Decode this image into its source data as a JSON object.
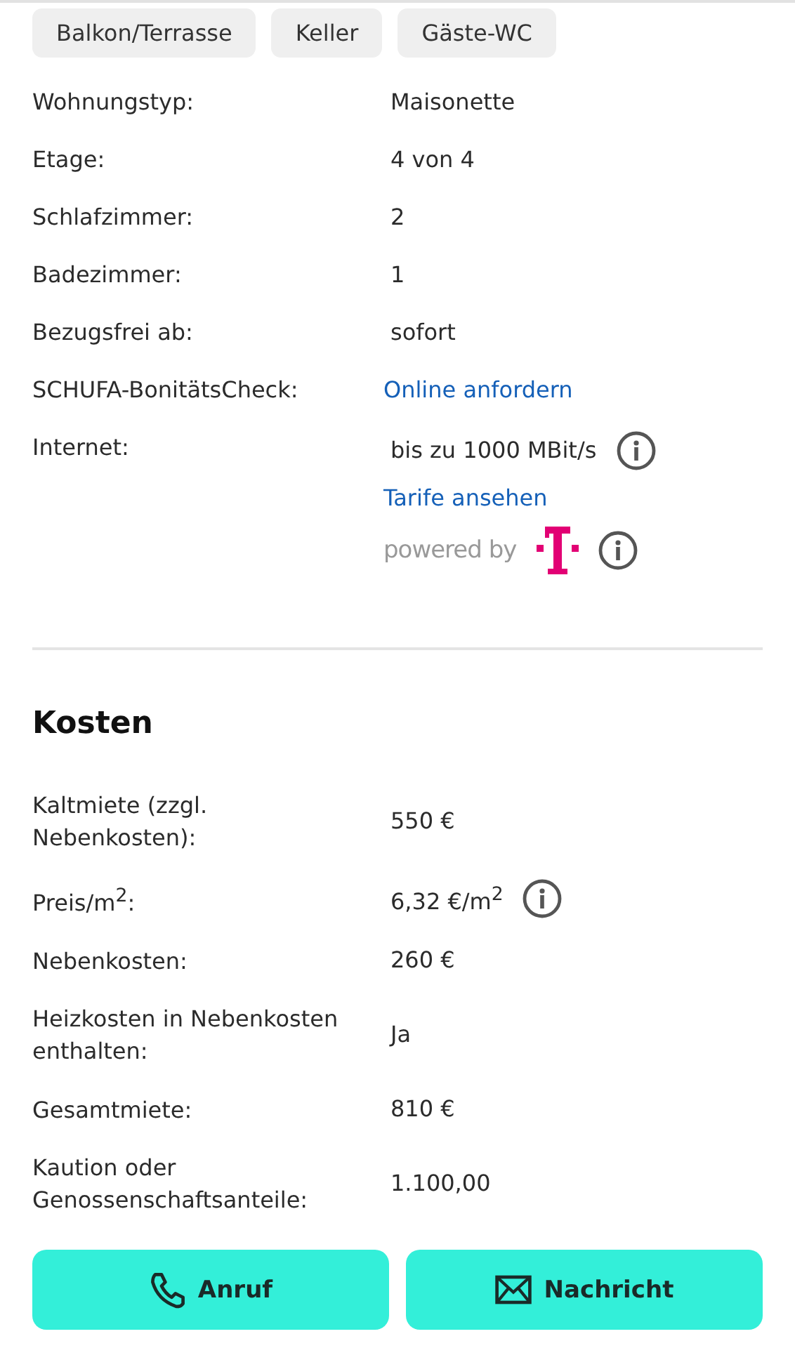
{
  "tags": [
    "Balkon/Terrasse",
    "Keller",
    "Gäste-WC"
  ],
  "details": [
    {
      "label": "Wohnungstyp:",
      "values": [
        {
          "kind": "text",
          "text": "Maisonette"
        }
      ]
    },
    {
      "label": "Etage:",
      "values": [
        {
          "kind": "text",
          "text": "4 von 4"
        }
      ]
    },
    {
      "label": "Schlafzimmer:",
      "values": [
        {
          "kind": "text",
          "text": "2"
        }
      ]
    },
    {
      "label": "Badezimmer:",
      "values": [
        {
          "kind": "text",
          "text": "1"
        }
      ]
    },
    {
      "label": "Bezugsfrei ab:",
      "values": [
        {
          "kind": "text",
          "text": "sofort"
        }
      ]
    },
    {
      "label": "SCHUFA-BonitätsCheck:",
      "values": [
        {
          "kind": "link",
          "text": "Online anfordern"
        }
      ]
    },
    {
      "label": "Internet:",
      "values": [
        {
          "kind": "text",
          "text": "bis zu 1000 MBit/s",
          "info": true
        },
        {
          "kind": "link",
          "text": "Tarife ansehen"
        },
        {
          "kind": "powered",
          "text": "powered by",
          "info": true
        }
      ]
    }
  ],
  "costs": {
    "title": "Kosten",
    "rows": [
      {
        "label": "Kaltmiete (zzgl. Nebenkosten):",
        "value": "550 €"
      },
      {
        "label": "Preis/m$^{2}$:",
        "value": "6,32 €/m$^{2}$",
        "info": true
      },
      {
        "label": "Nebenkosten:",
        "value": "260 €"
      },
      {
        "label": "Heizkosten in Nebenkosten enthalten:",
        "value": "Ja"
      },
      {
        "label": "Gesamtmiete:",
        "value": "810 €"
      },
      {
        "label": "Kaution oder Genossenschaftsanteile:",
        "value": "1.100,00"
      }
    ]
  },
  "actions": [
    {
      "kind": "call",
      "label": "Anruf"
    },
    {
      "kind": "message",
      "label": "Nachricht"
    }
  ]
}
